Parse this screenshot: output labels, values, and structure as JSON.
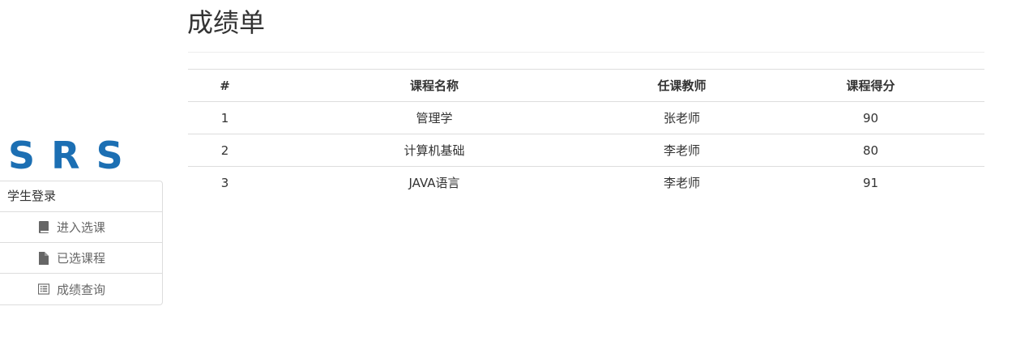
{
  "logo": {
    "letters": [
      "S",
      "R",
      "S"
    ],
    "color": "#1c6fb3"
  },
  "sidebar": {
    "header": "学生登录",
    "items": [
      {
        "label": "进入选课",
        "icon": "book-icon"
      },
      {
        "label": "已选课程",
        "icon": "file-icon"
      },
      {
        "label": "成绩查询",
        "icon": "list-alt-icon"
      }
    ]
  },
  "page": {
    "title": "成绩单"
  },
  "table": {
    "headers": [
      "#",
      "课程名称",
      "任课教师",
      "课程得分"
    ],
    "rows": [
      [
        "1",
        "管理学",
        "张老师",
        "90"
      ],
      [
        "2",
        "计算机基础",
        "李老师",
        "80"
      ],
      [
        "3",
        "JAVA语言",
        "李老师",
        "91"
      ]
    ]
  }
}
